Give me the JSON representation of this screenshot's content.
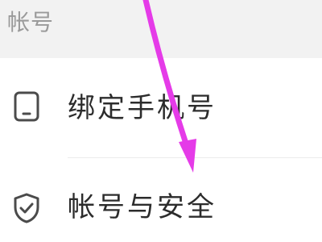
{
  "section": {
    "title": "帐号"
  },
  "items": [
    {
      "label": "绑定手机号",
      "icon": "phone-icon"
    },
    {
      "label": "帐号与安全",
      "icon": "shield-check-icon"
    }
  ],
  "colors": {
    "header_bg": "#f2f2f2",
    "header_text": "#9a9a9a",
    "row_text": "#2c2c2c",
    "icon": "#4b4b4b",
    "divider": "#ececec",
    "annotation_arrow": "#e53be8"
  },
  "annotation": {
    "icon": "arrow-down-icon"
  }
}
